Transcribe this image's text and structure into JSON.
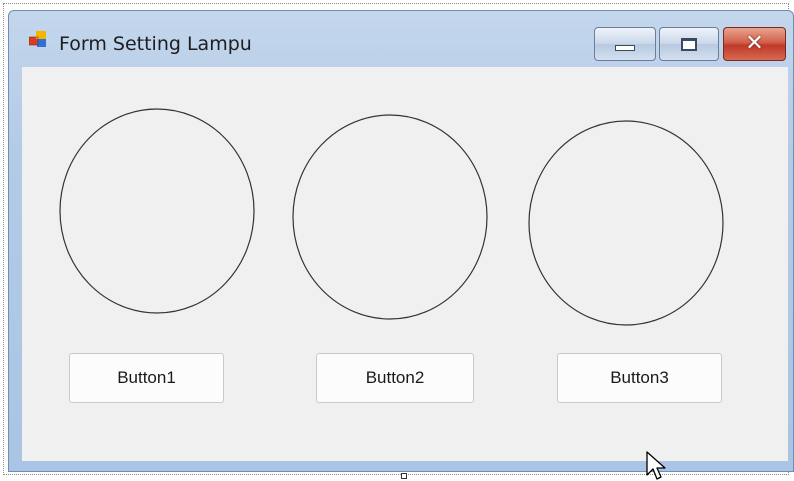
{
  "window": {
    "title": "Form Setting Lampu",
    "icon": "form-app-icon",
    "caption_buttons": [
      "minimize-icon",
      "maximize-icon",
      "close-icon"
    ],
    "close_glyph": "✕"
  },
  "form": {
    "lamps": [
      {
        "name": "lamp-1",
        "state": "off"
      },
      {
        "name": "lamp-2",
        "state": "off"
      },
      {
        "name": "lamp-3",
        "state": "off"
      }
    ],
    "buttons": [
      {
        "label": "Button1"
      },
      {
        "label": "Button2"
      },
      {
        "label": "Button3"
      }
    ]
  },
  "colors": {
    "title_bar": "#b4cbe6",
    "client_background": "#f0f0f0",
    "close_button": "#c0392b"
  }
}
